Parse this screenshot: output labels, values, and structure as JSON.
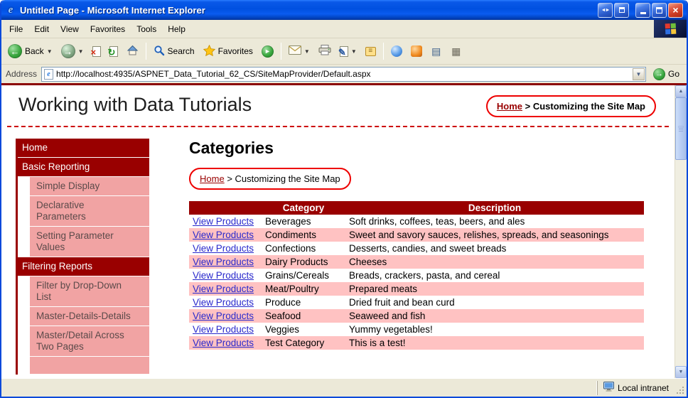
{
  "window": {
    "title": "Untitled Page - Microsoft Internet Explorer"
  },
  "menu": {
    "items": [
      "File",
      "Edit",
      "View",
      "Favorites",
      "Tools",
      "Help"
    ]
  },
  "toolbar": {
    "back_label": "Back",
    "search_label": "Search",
    "favorites_label": "Favorites"
  },
  "address": {
    "label": "Address",
    "url": "http://localhost:4935/ASPNET_Data_Tutorial_62_CS/SiteMapProvider/Default.aspx",
    "go_label": "Go"
  },
  "page": {
    "title": "Working with Data Tutorials",
    "breadcrumb_top": {
      "home": "Home",
      "separator": ">",
      "current": "Customizing the Site Map"
    },
    "breadcrumb_content": {
      "home": "Home",
      "separator": ">",
      "current": "Customizing the Site Map"
    },
    "sidebar": {
      "items": [
        {
          "label": "Home",
          "level": 1
        },
        {
          "label": "Basic Reporting",
          "level": 1
        },
        {
          "label": "Simple Display",
          "level": 2
        },
        {
          "label": "Declarative Parameters",
          "level": 2
        },
        {
          "label": "Setting Parameter Values",
          "level": 2
        },
        {
          "label": "Filtering Reports",
          "level": 1
        },
        {
          "label": "Filter by Drop-Down List",
          "level": 2
        },
        {
          "label": "Master-Details-Details",
          "level": 2
        },
        {
          "label": "Master/Detail Across Two Pages",
          "level": 2
        }
      ]
    },
    "main": {
      "heading": "Categories",
      "table": {
        "headers": [
          "",
          "Category",
          "Description"
        ],
        "link_label": "View Products",
        "rows": [
          {
            "category": "Beverages",
            "description": "Soft drinks, coffees, teas, beers, and ales"
          },
          {
            "category": "Condiments",
            "description": "Sweet and savory sauces, relishes, spreads, and seasonings"
          },
          {
            "category": "Confections",
            "description": "Desserts, candies, and sweet breads"
          },
          {
            "category": "Dairy Products",
            "description": "Cheeses"
          },
          {
            "category": "Grains/Cereals",
            "description": "Breads, crackers, pasta, and cereal"
          },
          {
            "category": "Meat/Poultry",
            "description": "Prepared meats"
          },
          {
            "category": "Produce",
            "description": "Dried fruit and bean curd"
          },
          {
            "category": "Seafood",
            "description": "Seaweed and fish"
          },
          {
            "category": "Veggies",
            "description": "Yummy vegetables!"
          },
          {
            "category": "Test Category",
            "description": "This is a test!"
          }
        ]
      }
    }
  },
  "status": {
    "zone": "Local intranet"
  },
  "colors": {
    "dark_red": "#990000",
    "sidebar_pink": "#f1a3a3",
    "table_pink": "#ffc2c2",
    "annotation_red": "#ee0000",
    "link_blue": "#2929cc",
    "titlebar_blue": "#0050e0"
  }
}
